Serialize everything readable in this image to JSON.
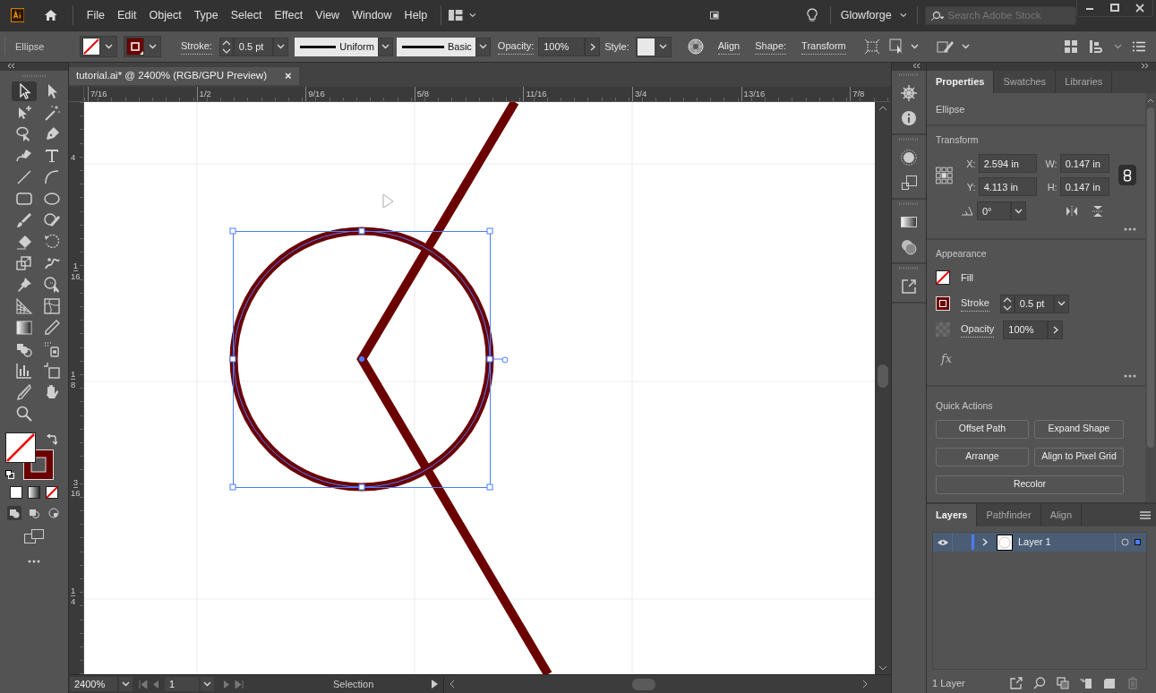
{
  "menu_bar": {
    "items": [
      "File",
      "Edit",
      "Object",
      "Type",
      "Select",
      "Effect",
      "View",
      "Window",
      "Help"
    ],
    "workspace": "Glowforge",
    "search": {
      "placeholder": "Search Adobe Stock"
    }
  },
  "control_bar": {
    "object_type": "Ellipse",
    "stroke_label": "Stroke:",
    "stroke_weight": "0.5 pt",
    "variable_width": "Uniform",
    "brush": "Basic",
    "opacity_label": "Opacity:",
    "opacity": "100%",
    "style_label": "Style:",
    "links": [
      "Align",
      "Shape:",
      "Transform"
    ]
  },
  "document": {
    "tab": {
      "title": "tutorial.ai* @ 2400% (RGB/GPU Preview)",
      "close": "×"
    },
    "ruler_top": [
      "7/16",
      "1/2",
      "9/16",
      "5/8",
      "11/16",
      "3/4",
      "13/16",
      "7/8"
    ],
    "ruler_left": [
      {
        "num": "4"
      },
      {
        "num": "1",
        "den": "16"
      },
      {
        "num": "1",
        "den": "8"
      },
      {
        "num": "3",
        "den": "16"
      },
      {
        "num": "1",
        "den": "4"
      }
    ]
  },
  "tools": [
    {
      "kind": "selection",
      "selected": true
    },
    {
      "kind": "direct",
      "selected": false
    },
    {
      "kind": "group",
      "selected": false
    },
    {
      "kind": "wand",
      "selected": false
    },
    {
      "kind": "lasso",
      "selected": false
    },
    {
      "kind": "pen",
      "selected": false
    },
    {
      "kind": "curvature",
      "selected": false
    },
    {
      "kind": "type",
      "selected": false
    },
    {
      "kind": "line",
      "selected": false
    },
    {
      "kind": "arc",
      "selected": false
    },
    {
      "kind": "rectangle",
      "selected": false
    },
    {
      "kind": "ellipse",
      "selected": false
    },
    {
      "kind": "brush",
      "selected": false
    },
    {
      "kind": "shaper",
      "selected": false
    },
    {
      "kind": "eraser",
      "selected": false
    },
    {
      "kind": "rotate",
      "selected": false
    },
    {
      "kind": "scale",
      "selected": false
    },
    {
      "kind": "puppet",
      "selected": false
    },
    {
      "kind": "pin",
      "selected": false
    },
    {
      "kind": "builder",
      "selected": false
    },
    {
      "kind": "perspective",
      "selected": false
    },
    {
      "kind": "mesh",
      "selected": false
    },
    {
      "kind": "gradient",
      "selected": false
    },
    {
      "kind": "eyedropper",
      "selected": false
    },
    {
      "kind": "blend",
      "selected": false
    },
    {
      "kind": "sprayer",
      "selected": false
    },
    {
      "kind": "graph",
      "selected": false
    },
    {
      "kind": "artboard",
      "selected": false
    },
    {
      "kind": "slice",
      "selected": false
    },
    {
      "kind": "hand",
      "selected": false
    },
    {
      "kind": "zoom",
      "selected": false
    }
  ],
  "status_bar": {
    "zoom": "2400%",
    "artboard": "1",
    "tool": "Selection"
  },
  "properties": {
    "tabs": [
      {
        "label": "Properties",
        "selected": true
      },
      {
        "label": "Swatches",
        "selected": false
      },
      {
        "label": "Libraries",
        "selected": false
      }
    ],
    "object_type": "Ellipse",
    "transform": {
      "title": "Transform",
      "fields": [
        {
          "label": "X:",
          "value": "2.594 in"
        },
        {
          "label": "W:",
          "value": "0.147 in"
        },
        {
          "label": "Y:",
          "value": "4.113 in"
        },
        {
          "label": "H:",
          "value": "0.147 in"
        }
      ],
      "angle": "0°"
    },
    "appearance": {
      "title": "Appearance",
      "fill": "Fill",
      "stroke": "Stroke",
      "stroke_weight": "0.5 pt",
      "opacity_label": "Opacity",
      "opacity": "100%",
      "effects": "fx"
    },
    "quick_actions": {
      "title": "Quick Actions",
      "buttons": [
        "Offset Path",
        "Expand Shape",
        "Arrange",
        "Align to Pixel Grid",
        "Recolor"
      ]
    }
  },
  "layers_panel": {
    "tabs": [
      {
        "label": "Layers",
        "selected": true
      },
      {
        "label": "Pathfinder",
        "selected": false
      },
      {
        "label": "Align",
        "selected": false
      }
    ],
    "layers": [
      {
        "name": "Layer 1",
        "selected": true,
        "visible": true
      }
    ],
    "count": "1 Layer"
  }
}
